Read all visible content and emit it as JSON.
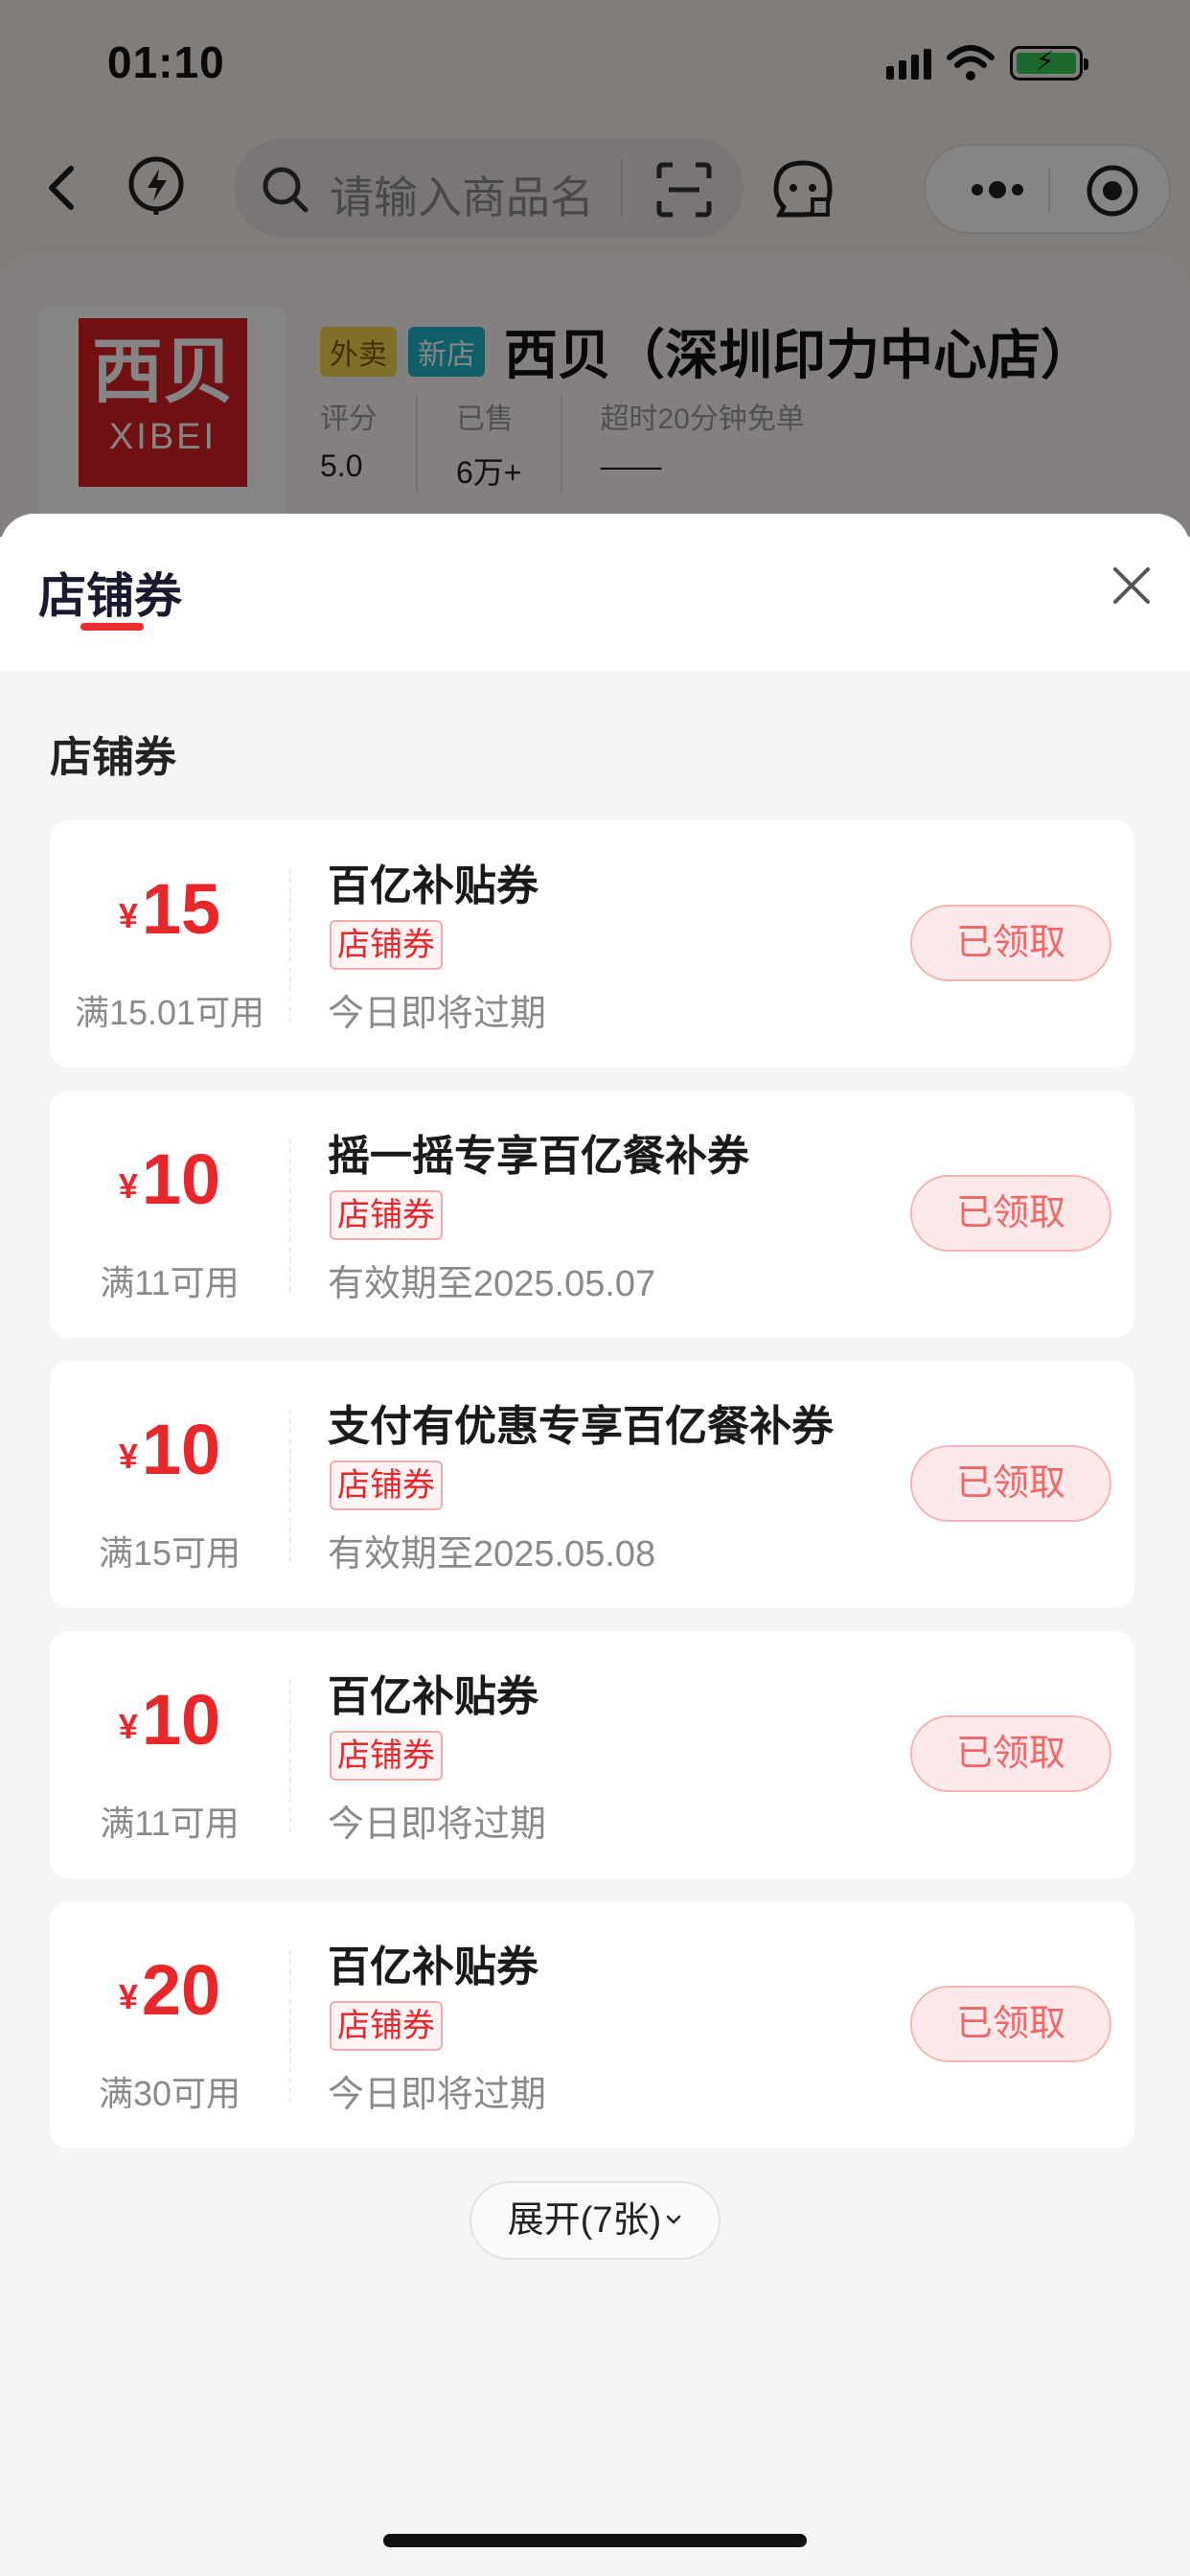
{
  "status_bar": {
    "time": "01:10",
    "icons": [
      "signal-icon",
      "wifi-icon",
      "battery-charging-icon"
    ]
  },
  "nav": {
    "search_placeholder": "请输入商品名",
    "icons": [
      "back-icon",
      "lightning-icon",
      "search-icon",
      "scan-icon",
      "customer-service-icon",
      "more-icon",
      "target-icon"
    ]
  },
  "shop": {
    "logo_cn": "西贝",
    "logo_en": "XIBEI",
    "tag_delivery": "外卖",
    "tag_new": "新店",
    "name": "西贝（深圳印力中心店）",
    "stats": [
      {
        "label": "评分",
        "value": "5.0"
      },
      {
        "label": "已售",
        "value": "6万+"
      },
      {
        "label": "超时20分钟免单",
        "value": "——"
      }
    ]
  },
  "sheet": {
    "title": "店铺券",
    "section_title": "店铺券",
    "coupons": [
      {
        "currency": "¥",
        "amount": "15",
        "condition": "满15.01可用",
        "name": "百亿补贴券",
        "badge": "店铺券",
        "validity": "今日即将过期",
        "button": "已领取"
      },
      {
        "currency": "¥",
        "amount": "10",
        "condition": "满11可用",
        "name": "摇一摇专享百亿餐补券",
        "badge": "店铺券",
        "validity": "有效期至2025.05.07",
        "button": "已领取"
      },
      {
        "currency": "¥",
        "amount": "10",
        "condition": "满15可用",
        "name": "支付有优惠专享百亿餐补券",
        "badge": "店铺券",
        "validity": "有效期至2025.05.08",
        "button": "已领取"
      },
      {
        "currency": "¥",
        "amount": "10",
        "condition": "满11可用",
        "name": "百亿补贴券",
        "badge": "店铺券",
        "validity": "今日即将过期",
        "button": "已领取"
      },
      {
        "currency": "¥",
        "amount": "20",
        "condition": "满30可用",
        "name": "百亿补贴券",
        "badge": "店铺券",
        "validity": "今日即将过期",
        "button": "已领取"
      }
    ],
    "expand_label": "展开(7张)"
  },
  "colors": {
    "accent": "#e8272b",
    "claimed_bg": "#fde9e9",
    "overlay": "rgba(0,0,0,0.48)"
  }
}
